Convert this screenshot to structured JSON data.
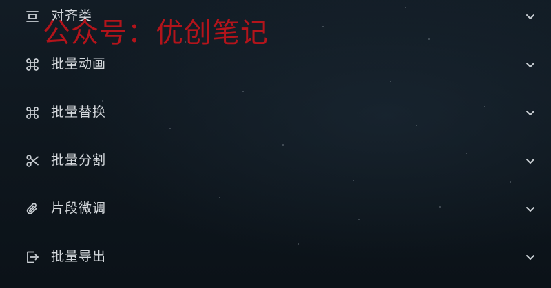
{
  "menu": {
    "items": [
      {
        "label": "对齐类",
        "icon": "align-icon"
      },
      {
        "label": "批量动画",
        "icon": "command-icon"
      },
      {
        "label": "批量替换",
        "icon": "command-icon"
      },
      {
        "label": "批量分割",
        "icon": "scissors-icon"
      },
      {
        "label": "片段微调",
        "icon": "paperclip-icon"
      },
      {
        "label": "批量导出",
        "icon": "export-icon"
      }
    ],
    "expand_icon": "chevron-down-icon"
  },
  "watermark": {
    "text": "公众号：优创笔记"
  },
  "colors": {
    "background": "#0f1820",
    "text": "#d4d8dc",
    "icon": "#c9ced3",
    "watermark": "#b3141b"
  }
}
